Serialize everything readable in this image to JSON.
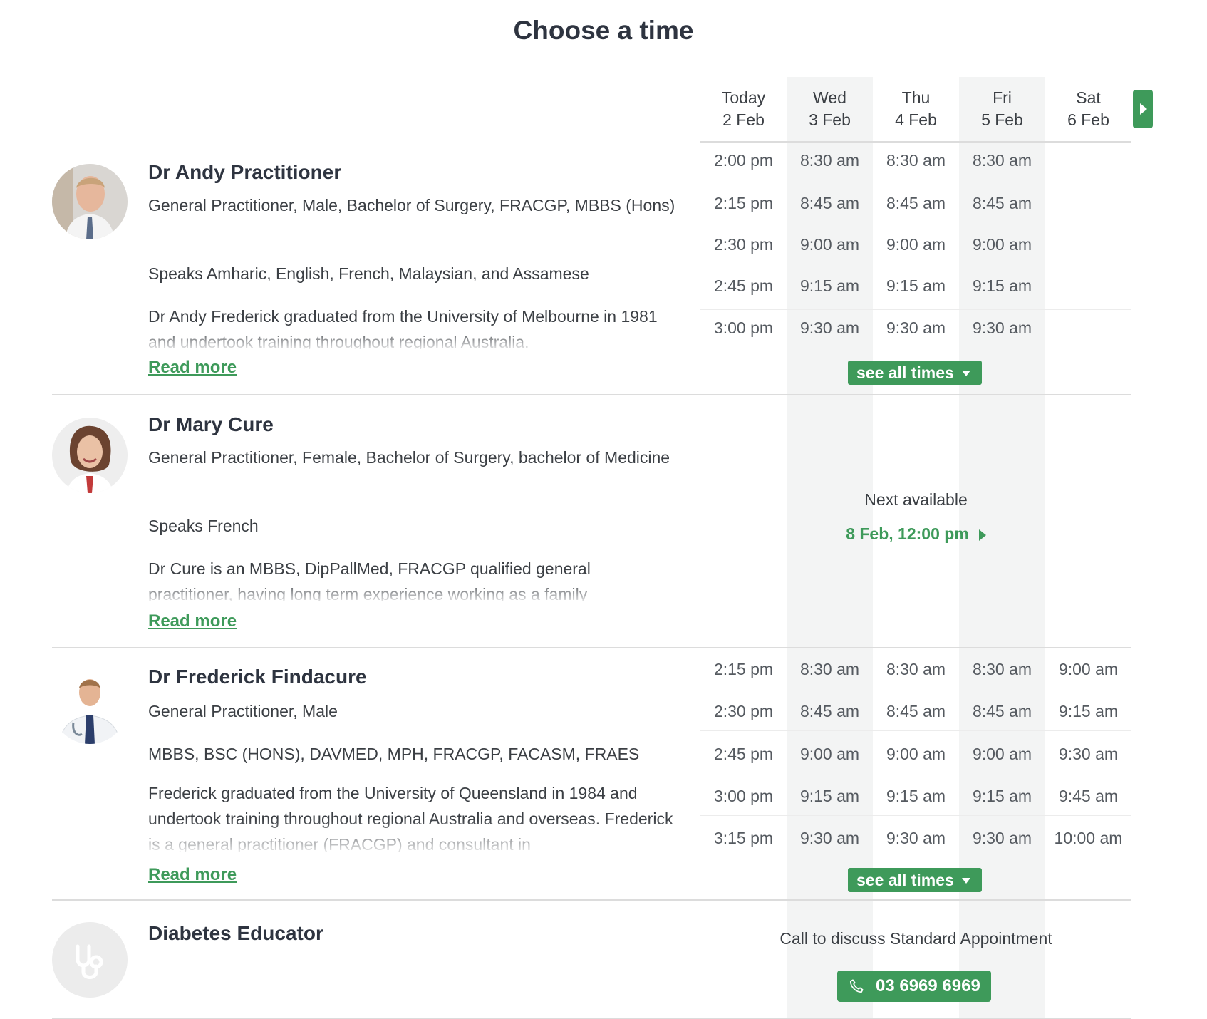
{
  "title": "Choose a time",
  "days": [
    {
      "day": "Today",
      "date": "2 Feb"
    },
    {
      "day": "Wed",
      "date": "3 Feb"
    },
    {
      "day": "Thu",
      "date": "4 Feb"
    },
    {
      "day": "Fri",
      "date": "5 Feb"
    },
    {
      "day": "Sat",
      "date": "6 Feb"
    }
  ],
  "read_more": "Read more",
  "see_all_times": "see all times",
  "practitioners": [
    {
      "name": "Dr Andy Practitioner",
      "details": "General Practitioner, Male, Bachelor of Surgery, FRACGP, MBBS (Hons)",
      "languages": "Speaks Amharic, English, French, Malaysian, and Assamese",
      "bio": "Dr Andy Frederick graduated from the University of Melbourne in 1981 and undertook training throughout regional Australia.",
      "times": [
        [
          "2:00 pm",
          "8:30 am",
          "8:30 am",
          "8:30 am",
          ""
        ],
        [
          "2:15 pm",
          "8:45 am",
          "8:45 am",
          "8:45 am",
          ""
        ],
        [
          "2:30 pm",
          "9:00 am",
          "9:00 am",
          "9:00 am",
          ""
        ],
        [
          "2:45 pm",
          "9:15 am",
          "9:15 am",
          "9:15 am",
          ""
        ],
        [
          "3:00 pm",
          "9:30 am",
          "9:30 am",
          "9:30 am",
          ""
        ]
      ]
    },
    {
      "name": "Dr Mary Cure",
      "details": "General Practitioner, Female, Bachelor of Surgery, bachelor of Medicine",
      "languages": "Speaks French",
      "bio": "Dr Cure is an MBBS, DipPallMed, FRACGP qualified general practitioner, having long term experience working as a family",
      "next_available_label": "Next available",
      "next_available_value": "8 Feb, 12:00 pm"
    },
    {
      "name": "Dr Frederick Findacure",
      "details": "General Practitioner, Male",
      "qualifications": "MBBS, BSC (HONS), DAVMED, MPH, FRACGP, FACASM, FRAES",
      "bio": "Frederick graduated from the University of Queensland in 1984 and undertook training throughout regional Australia and overseas. Frederick is a general practitioner (FRACGP) and consultant in",
      "times": [
        [
          "2:15 pm",
          "8:30 am",
          "8:30 am",
          "8:30 am",
          "9:00 am"
        ],
        [
          "2:30 pm",
          "8:45 am",
          "8:45 am",
          "8:45 am",
          "9:15 am"
        ],
        [
          "2:45 pm",
          "9:00 am",
          "9:00 am",
          "9:00 am",
          "9:30 am"
        ],
        [
          "3:00 pm",
          "9:15 am",
          "9:15 am",
          "9:15 am",
          "9:45 am"
        ],
        [
          "3:15 pm",
          "9:30 am",
          "9:30 am",
          "9:30 am",
          "10:00 am"
        ]
      ]
    },
    {
      "name": "Diabetes Educator",
      "call_text": "Call to discuss Standard Appointment",
      "phone": "03 6969 6969"
    }
  ],
  "colors": {
    "accent": "#3e9a5a",
    "column_shade": "#f3f4f4",
    "divider": "#dcdcdc"
  },
  "icons": [
    "chevron-right-icon",
    "caret-down-icon",
    "phone-icon",
    "stethoscope-icon"
  ]
}
